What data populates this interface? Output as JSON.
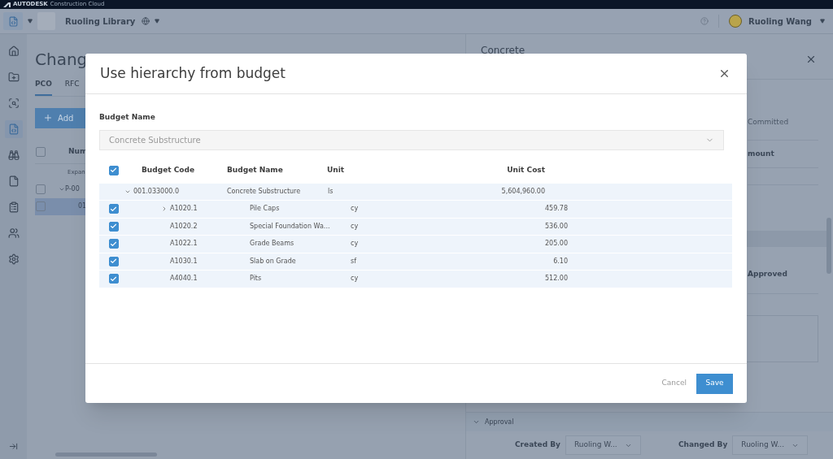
{
  "top_bar": {
    "brand": "AUTODESK",
    "product": "Construction Cloud"
  },
  "header": {
    "project": "Ruoling Library",
    "user": "Ruoling Wang"
  },
  "sidebar": {
    "items": [
      {
        "kind": "home",
        "selected": false
      },
      {
        "kind": "folder",
        "selected": false
      },
      {
        "kind": "scan",
        "selected": false
      },
      {
        "kind": "code",
        "selected": true
      },
      {
        "kind": "binoculars",
        "selected": false
      },
      {
        "kind": "file",
        "selected": false
      },
      {
        "kind": "clipboard",
        "selected": false
      },
      {
        "kind": "users",
        "selected": false
      },
      {
        "kind": "settings",
        "selected": false
      }
    ]
  },
  "page": {
    "title": "Chang",
    "tabs": [
      {
        "label": "PCO",
        "selected": true
      },
      {
        "label": "RFC",
        "selected": false
      }
    ],
    "add_button": "Add",
    "all_checked": false,
    "column_1": "Num",
    "hint": "Expan",
    "rows": [
      {
        "text": "P-00",
        "kind": "group",
        "selected": false,
        "checked": false
      },
      {
        "text": "01",
        "kind": "item",
        "selected": true,
        "checked": false
      }
    ]
  },
  "side_panel": {
    "title": "Concrete",
    "committed": "Committed",
    "amount": "mount",
    "status": "Approved",
    "section": "Approval",
    "created_by_label": "Created By",
    "created_by": "Ruoling W...",
    "changed_by_label": "Changed By",
    "changed_by": "Ruoling W..."
  },
  "dialog": {
    "title": "Use hierarchy from budget",
    "budget_label": "Budget Name",
    "budget_value": "Concrete Substructure",
    "columns": [
      "Budget Code",
      "Budget Name",
      "Unit",
      "Unit Cost"
    ],
    "all_checked": true,
    "rows": [
      {
        "code": "001.033000.0",
        "name": "Concrete Substructure",
        "unit": "ls",
        "cost": "5,604,960.00",
        "expanded": true,
        "children": [
          {
            "kind": "group",
            "code": "A1020.1",
            "name": "Pile Caps",
            "unit": "cy",
            "cost": "459.78",
            "checked": true,
            "expanded": false
          },
          {
            "kind": "leaf",
            "code": "A1020.2",
            "name": "Special Foundation Wa...",
            "unit": "cy",
            "cost": "536.00",
            "checked": true
          },
          {
            "kind": "leaf",
            "code": "A1022.1",
            "name": "Grade Beams",
            "unit": "cy",
            "cost": "205.00",
            "checked": true
          },
          {
            "kind": "leaf",
            "code": "A1030.1",
            "name": "Slab on Grade",
            "unit": "sf",
            "cost": "6.10",
            "checked": true
          },
          {
            "kind": "leaf",
            "code": "A4040.1",
            "name": "Pits",
            "unit": "cy",
            "cost": "512.00",
            "checked": true
          }
        ]
      }
    ],
    "cancel": "Cancel",
    "save": "Save"
  }
}
